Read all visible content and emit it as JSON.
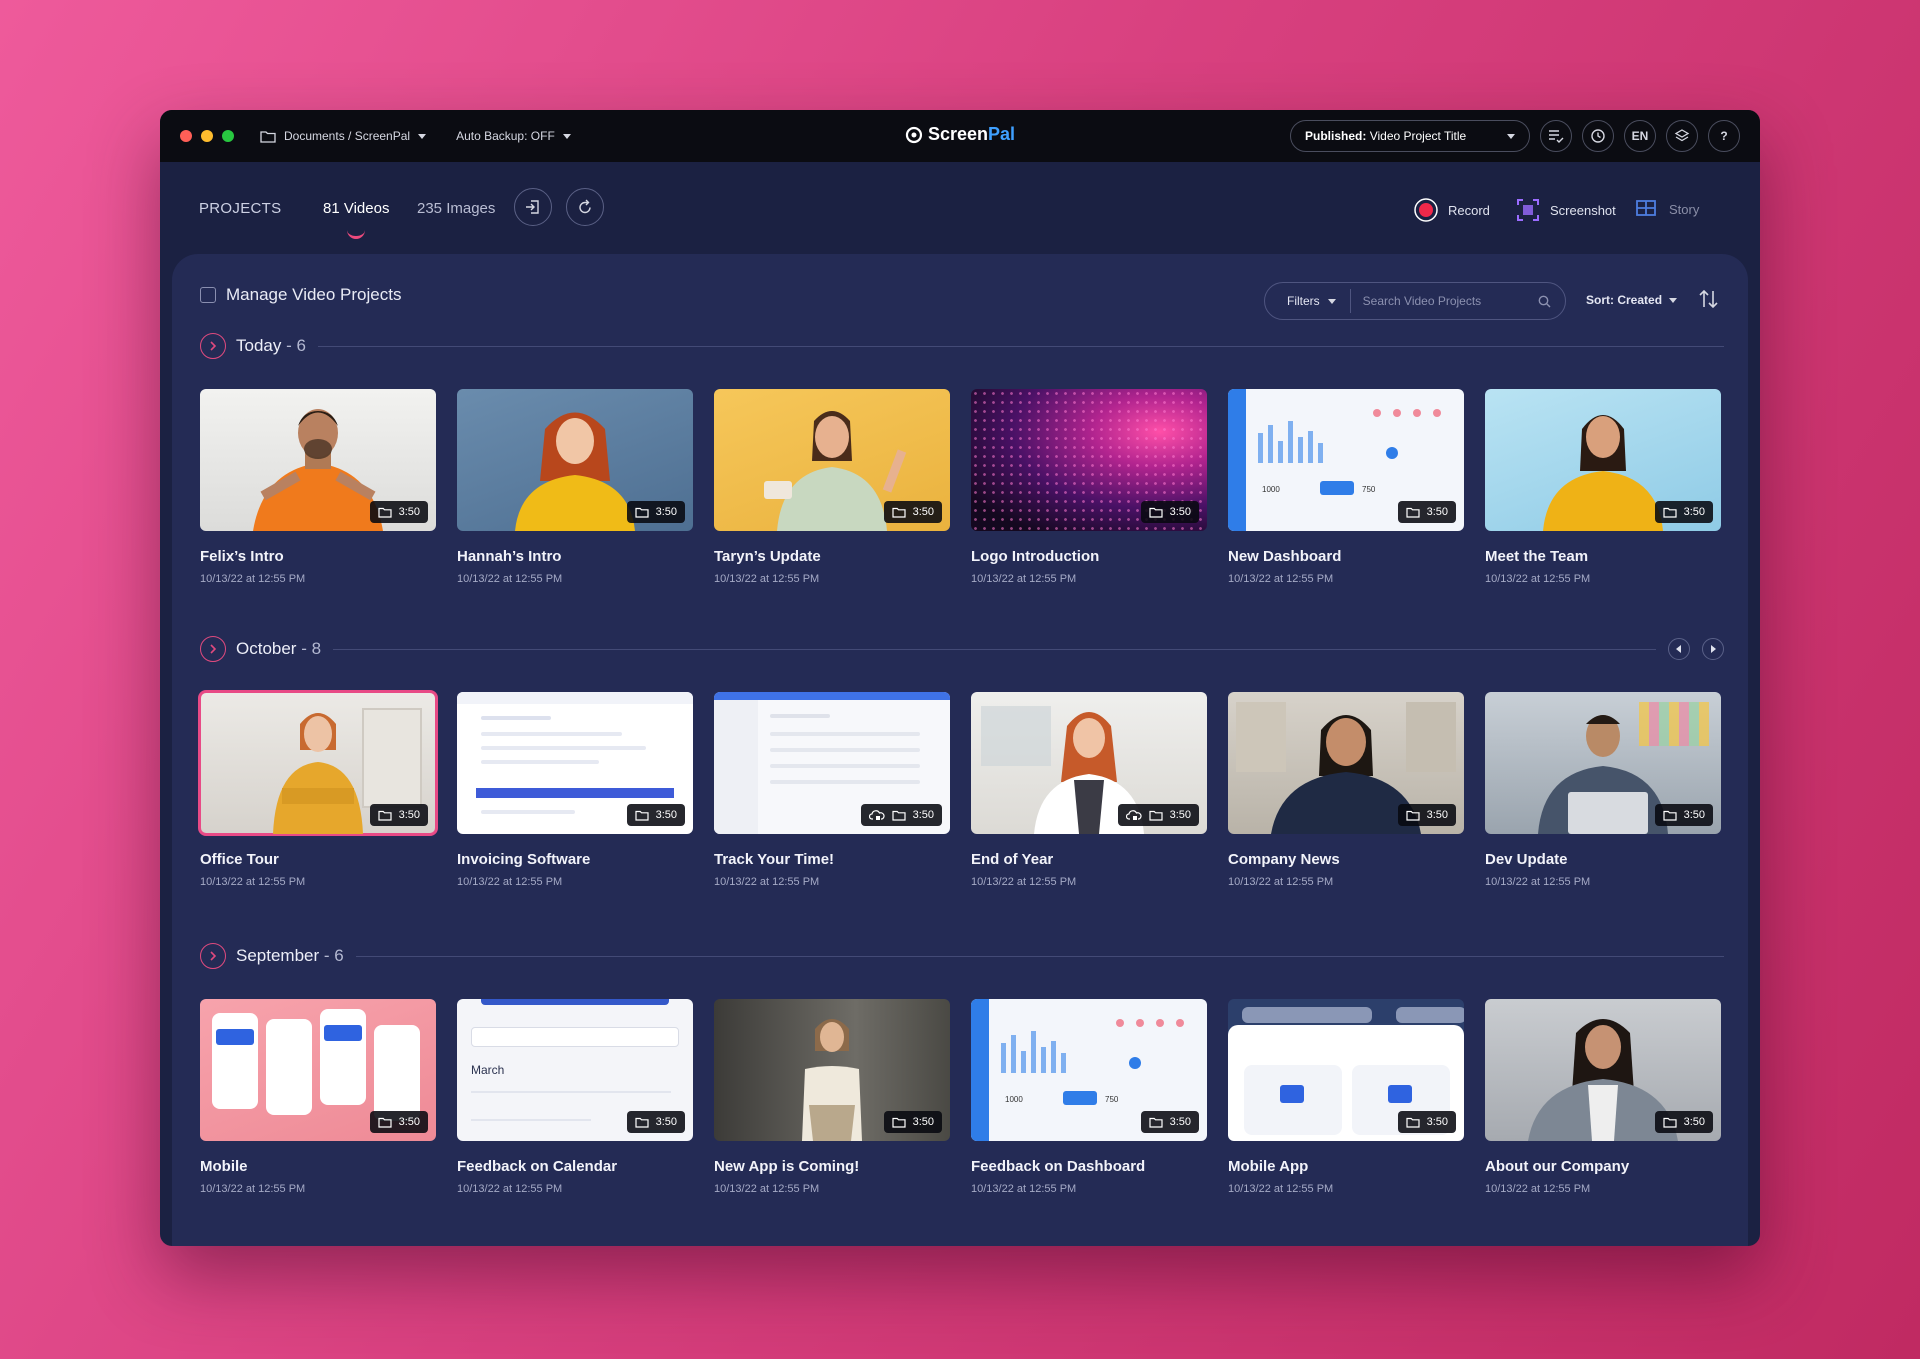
{
  "titlebar": {
    "location": "Documents / ScreenPal",
    "auto_backup": "Auto Backup: OFF",
    "logo_screen": "Screen",
    "logo_pal": "Pal",
    "published_prefix": "Published:",
    "published_title": "Video Project Title",
    "lang": "EN"
  },
  "header": {
    "projects": "PROJECTS",
    "tabs": [
      {
        "label": "81 Videos"
      },
      {
        "label": "235 Images"
      }
    ],
    "record": "Record",
    "screenshot": "Screenshot",
    "story": "Story"
  },
  "toolbar": {
    "manage": "Manage Video Projects",
    "filters": "Filters",
    "search_placeholder": "Search Video Projects",
    "sort_prefix": "Sort:",
    "sort_value": "Created"
  },
  "colors": {
    "accent_pink": "#e84a86",
    "panel": "#242b55",
    "window": "#1b2142",
    "logo_blue": "#3fa0ff"
  },
  "sections": [
    {
      "title": "Today",
      "count": "- 6",
      "cards": [
        {
          "title": "Felix’s Intro",
          "date": "10/13/22 at 12:55 PM",
          "duration": "3:50"
        },
        {
          "title": "Hannah’s Intro",
          "date": "10/13/22 at 12:55 PM",
          "duration": "3:50"
        },
        {
          "title": "Taryn’s Update",
          "date": "10/13/22 at 12:55 PM",
          "duration": "3:50"
        },
        {
          "title": "Logo Introduction",
          "date": "10/13/22 at 12:55 PM",
          "duration": "3:50"
        },
        {
          "title": "New Dashboard",
          "date": "10/13/22 at 12:55 PM",
          "duration": "3:50"
        },
        {
          "title": "Meet the Team",
          "date": "10/13/22 at 12:55 PM",
          "duration": "3:50"
        }
      ]
    },
    {
      "title": "October",
      "count": "- 8",
      "cards": [
        {
          "title": "Office Tour",
          "date": "10/13/22 at 12:55 PM",
          "duration": "3:50"
        },
        {
          "title": "Invoicing Software",
          "date": "10/13/22 at 12:55 PM",
          "duration": "3:50"
        },
        {
          "title": "Track Your Time!",
          "date": "10/13/22 at 12:55 PM",
          "duration": "3:50"
        },
        {
          "title": "End of Year",
          "date": "10/13/22 at 12:55 PM",
          "duration": "3:50"
        },
        {
          "title": "Company News",
          "date": "10/13/22 at 12:55 PM",
          "duration": "3:50"
        },
        {
          "title": "Dev Update",
          "date": "10/13/22 at 12:55 PM",
          "duration": "3:50"
        }
      ]
    },
    {
      "title": "September",
      "count": "- 6",
      "cards": [
        {
          "title": "Mobile",
          "date": "10/13/22 at 12:55 PM",
          "duration": "3:50"
        },
        {
          "title": "Feedback on Calendar",
          "date": "10/13/22 at 12:55 PM",
          "duration": "3:50"
        },
        {
          "title": "New App is Coming!",
          "date": "10/13/22 at 12:55 PM",
          "duration": "3:50"
        },
        {
          "title": "Feedback on Dashboard",
          "date": "10/13/22 at 12:55 PM",
          "duration": "3:50"
        },
        {
          "title": "Mobile App",
          "date": "10/13/22 at 12:55 PM",
          "duration": "3:50"
        },
        {
          "title": "About our Company",
          "date": "10/13/22 at 12:55 PM",
          "duration": "3:50"
        }
      ]
    }
  ]
}
